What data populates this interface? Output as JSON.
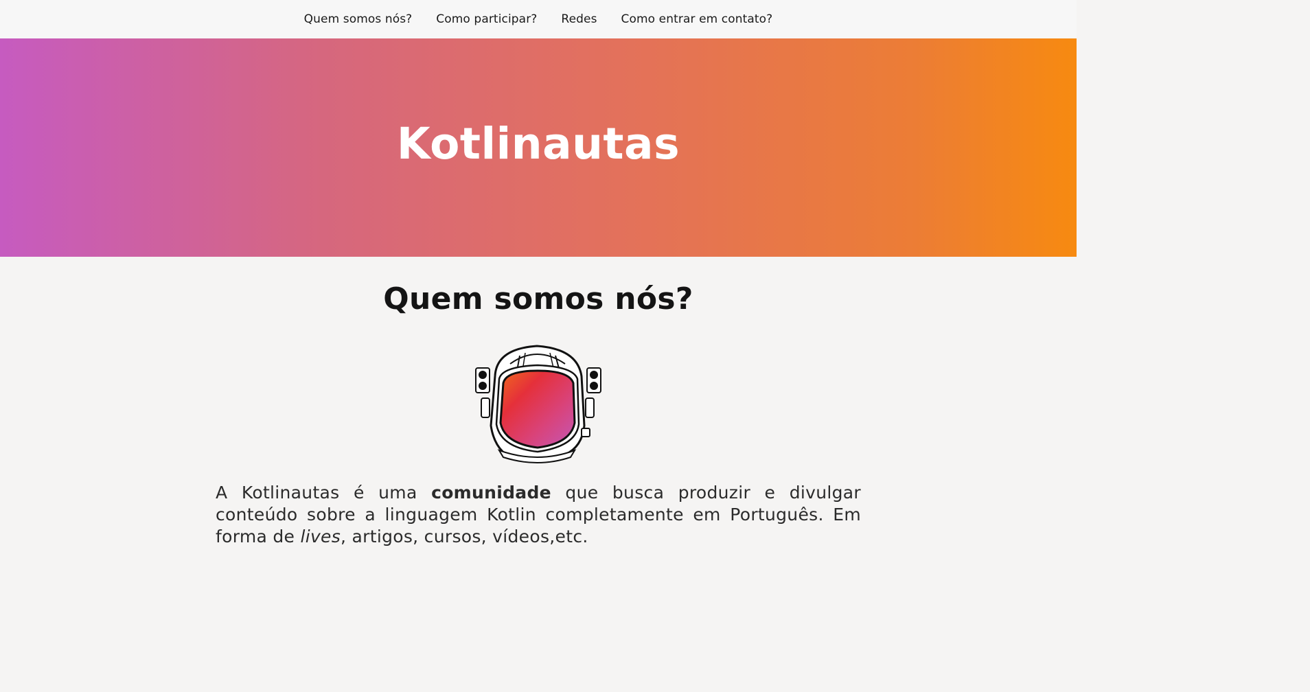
{
  "nav": {
    "items": [
      {
        "label": "Quem somos nós?"
      },
      {
        "label": "Como participar?"
      },
      {
        "label": "Redes"
      },
      {
        "label": "Como entrar em contato?"
      }
    ]
  },
  "hero": {
    "title": "Kotlinautas",
    "gradient_start": "#c65bc0",
    "gradient_end": "#f78a10"
  },
  "about": {
    "title": "Quem somos nós?",
    "image_icon": "astronaut-helmet-icon",
    "text_part1": "A Kotlinautas é uma ",
    "text_bold": "comunidade",
    "text_part2": " que busca produzir e divulgar conteúdo sobre a linguagem Kotlin completamente em Português. Em forma de ",
    "text_italic": "lives",
    "text_part3": ", artigos, cursos, vídeos,etc."
  }
}
